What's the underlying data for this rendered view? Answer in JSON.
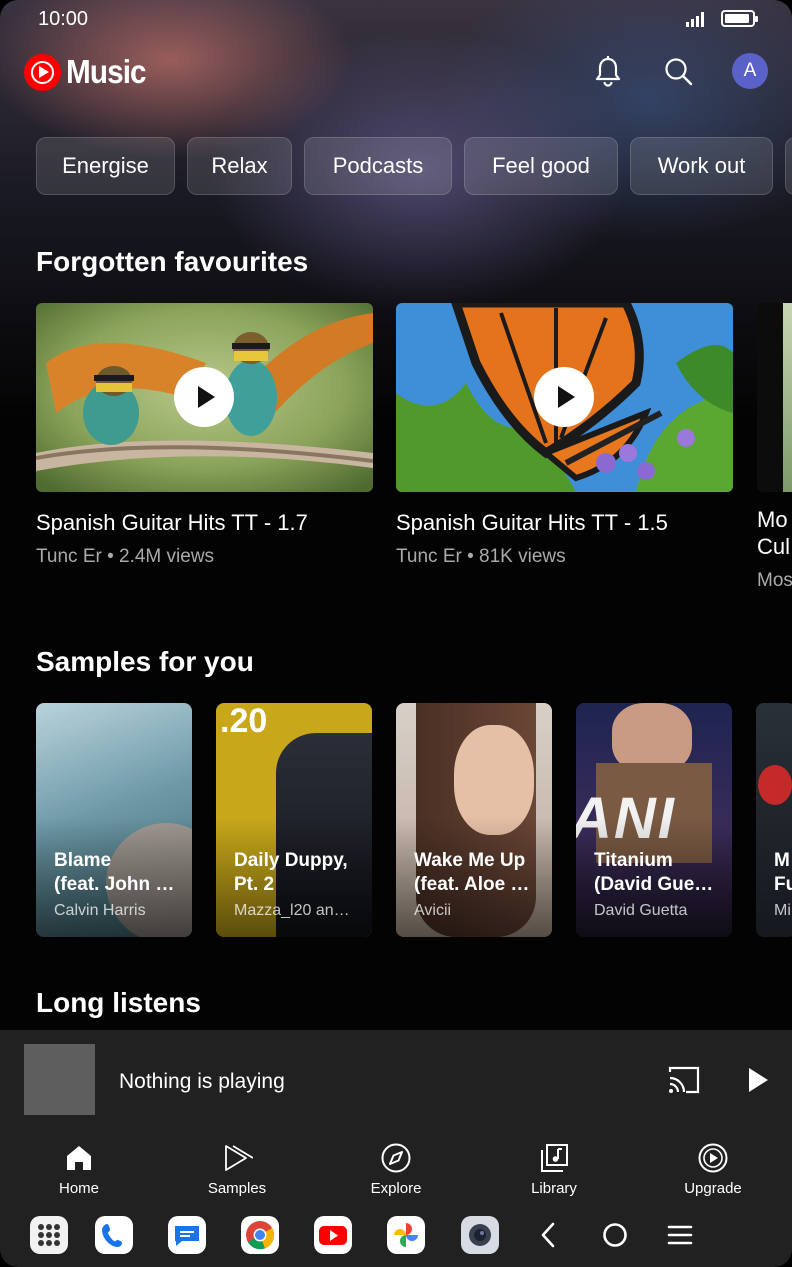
{
  "status": {
    "time": "10:00"
  },
  "header": {
    "app_name": "Music",
    "icons": [
      "notifications-icon",
      "search-icon"
    ],
    "avatar_letter": "A"
  },
  "chips": [
    "Energise",
    "Relax",
    "Podcasts",
    "Feel good",
    "Work out"
  ],
  "sections": {
    "forgotten": {
      "title": "Forgotten favourites",
      "items": [
        {
          "title": "Spanish Guitar Hits TT - 1.7",
          "meta": "Tunc Er • 2.4M views"
        },
        {
          "title": "Spanish  Guitar  Hits  TT - 1.5",
          "meta": "Tunc Er • 81K views"
        },
        {
          "title": "Mo",
          "title2": "Cul",
          "meta": "Mos"
        }
      ]
    },
    "samples": {
      "title": "Samples for you",
      "items": [
        {
          "title1": "Blame",
          "title2": "(feat. John …",
          "artist": "Calvin Harris"
        },
        {
          "title1": "Daily Duppy,",
          "title2": "Pt. 2",
          "artist": "Mazza_l20 an…"
        },
        {
          "title1": "Wake Me Up",
          "title2": "(feat. Aloe …",
          "artist": "Avicii"
        },
        {
          "title1": "Titanium",
          "title2": "(David Gue…",
          "artist": "David Guetta"
        },
        {
          "title1": "M",
          "title2": "Fu",
          "artist": "Mi"
        }
      ],
      "cover_text": {
        "daily_duppy": ".20",
        "titanium": "ANI"
      }
    },
    "long_listens": {
      "title": "Long listens"
    }
  },
  "player": {
    "status_text": "Nothing is playing"
  },
  "bottom_nav": [
    {
      "label": "Home",
      "icon": "home-icon",
      "active": true
    },
    {
      "label": "Samples",
      "icon": "samples-icon",
      "active": false
    },
    {
      "label": "Explore",
      "icon": "compass-icon",
      "active": false
    },
    {
      "label": "Library",
      "icon": "library-icon",
      "active": false
    },
    {
      "label": "Upgrade",
      "icon": "upgrade-icon",
      "active": false
    }
  ],
  "system_apps": [
    "apps-grid-icon",
    "phone-icon",
    "messages-icon",
    "chrome-icon",
    "youtube-icon",
    "photos-icon",
    "camera-icon"
  ],
  "colors": {
    "brand_red": "#ff0000",
    "avatar_bg": "#5a62c8",
    "surface": "#212121"
  }
}
